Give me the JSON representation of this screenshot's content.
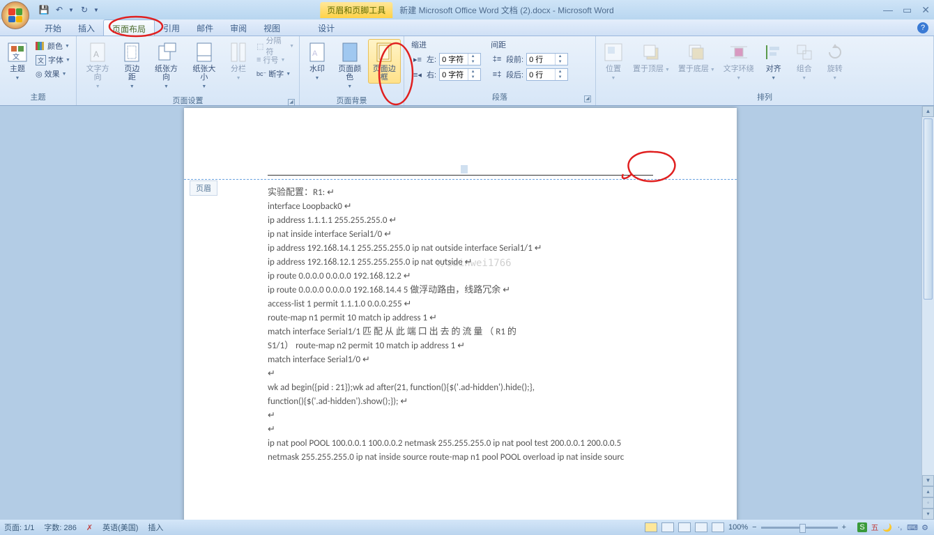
{
  "title": {
    "context_tab": "页眉和页脚工具",
    "doc_title": "新建 Microsoft Office Word 文档 (2).docx - Microsoft Word"
  },
  "menus": {
    "home": "开始",
    "insert": "插入",
    "layout": "页面布局",
    "ref": "引用",
    "mail": "邮件",
    "review": "审阅",
    "view": "视图",
    "design": "设计"
  },
  "quickaccess": {
    "save_icon": "save-icon",
    "undo_icon": "undo-icon",
    "redo_icon": "redo-icon"
  },
  "ribbon": {
    "theme": {
      "label": "主题",
      "themes": "主题",
      "colors": "颜色",
      "fonts": "字体",
      "effects": "效果"
    },
    "pagesetup": {
      "label": "页面设置",
      "textdir": "文字方向",
      "margins": "页边距",
      "orient": "纸张方向",
      "size": "纸张大小",
      "columns": "分栏",
      "breaks": "分隔符",
      "linenum": "行号",
      "hyphen": "断字"
    },
    "pagebg": {
      "label": "页面背景",
      "watermark": "水印",
      "pagecolor": "页面颜色",
      "border": "页面边框"
    },
    "paragraph": {
      "label": "段落",
      "indent_label": "缩进",
      "spacing_label": "间距",
      "left_lbl": "左:",
      "right_lbl": "右:",
      "before_lbl": "段前:",
      "after_lbl": "段后:",
      "left_val": "0 字符",
      "right_val": "0 字符",
      "before_val": "0 行",
      "after_val": "0 行"
    },
    "arrange": {
      "label": "排列",
      "position": "位置",
      "front": "置于顶层",
      "back": "置于底层",
      "wrap": "文字环绕",
      "align": "对齐",
      "group": "组合",
      "rotate": "旋转"
    }
  },
  "page": {
    "header_tag": "页眉",
    "lines": [
      "实验配置：R1: ↵",
      "  interface Loopback0  ↵",
      "     ip address 1.1.1.1 255.255.255.0 ↵",
      "ip nat inside interface Serial1/0  ↵",
      "   ip address 192.168.14.1 255.255.255.0     ip nat outside interface Serial1/1  ↵",
      " ip address 192.168.12.1 255.255.255.0  ip nat outside ↵",
      "ip route 0.0.0.0 0.0.0.0 192.168.12.2  ↵",
      "ip route 0.0.0.0 0.0.0.0 192.168.14.4  5   做浮动路由，线路冗余  ↵",
      "access-list 1 permit 1.1.1.0 0.0.0.255  ↵",
      "route-map n1 permit 10   match ip address 1 ↵",
      "  match interface Serial1/1    匹   配   从   此   端   口   出   去   的   流   量   （   R1     的",
      "S1/1）   route-map n2 permit 10   match ip address 1  ↵",
      " match interface Serial1/0   ↵",
      "↵",
      "     wk  ad  begin({pid            :            21});wk  ad  after(21,           function(){$('.ad-hidden').hide();},",
      "function(){$('.ad-hidden').show();});         ↵",
      "↵",
      "↵",
      "ip nat pool POOL 100.0.0.1 100.0.0.2 netmask 255.255.255.0 ip nat pool test 200.0.0.1 200.0.0.5",
      "netmask 255.255.255.0 ip nat inside source route-map n1 pool POOL overload ip nat inside sourc"
    ],
    "watermark": "t/zainwei1766"
  },
  "status": {
    "page": "页面: 1/1",
    "words": "字数: 286",
    "lang": "英语(美国)",
    "mode": "插入",
    "zoom": "100%",
    "minus": "−",
    "plus": "+"
  }
}
